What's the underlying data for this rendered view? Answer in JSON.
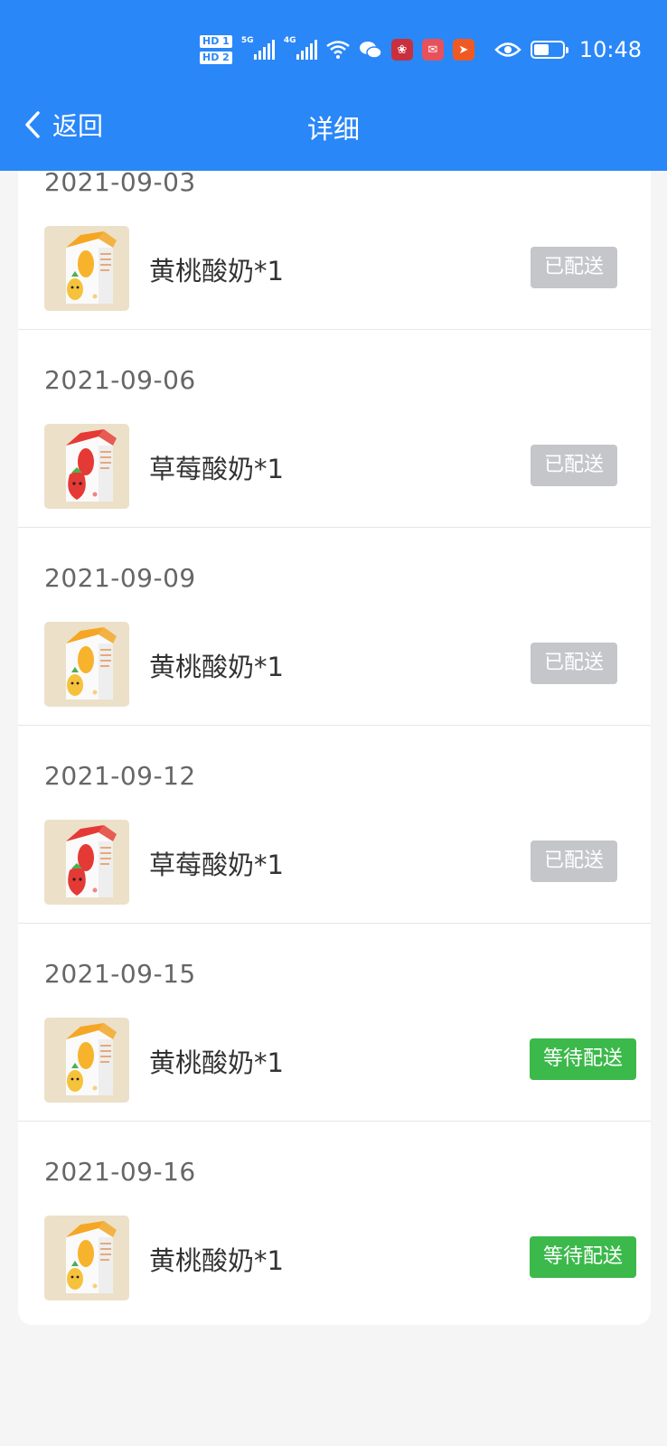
{
  "status_bar": {
    "hd1": "HD 1",
    "hd2": "HD 2",
    "net1": "5G",
    "net2": "4G",
    "time": "10:48",
    "battery_level": 0.55
  },
  "nav": {
    "back_label": "返回",
    "title": "详细"
  },
  "entries": [
    {
      "date": "2021-09-03",
      "product": "黄桃酸奶*1",
      "status": "已配送",
      "flavor": "peach"
    },
    {
      "date": "2021-09-06",
      "product": "草莓酸奶*1",
      "status": "已配送",
      "flavor": "strawberry"
    },
    {
      "date": "2021-09-09",
      "product": "黄桃酸奶*1",
      "status": "已配送",
      "flavor": "peach"
    },
    {
      "date": "2021-09-12",
      "product": "草莓酸奶*1",
      "status": "已配送",
      "flavor": "strawberry"
    },
    {
      "date": "2021-09-15",
      "product": "黄桃酸奶*1",
      "status": "等待配送",
      "flavor": "peach"
    },
    {
      "date": "2021-09-16",
      "product": "黄桃酸奶*1",
      "status": "等待配送",
      "flavor": "peach"
    }
  ],
  "colors": {
    "header": "#2a87f8",
    "delivered": "#c4c6c9",
    "waiting": "#3cb94b"
  }
}
